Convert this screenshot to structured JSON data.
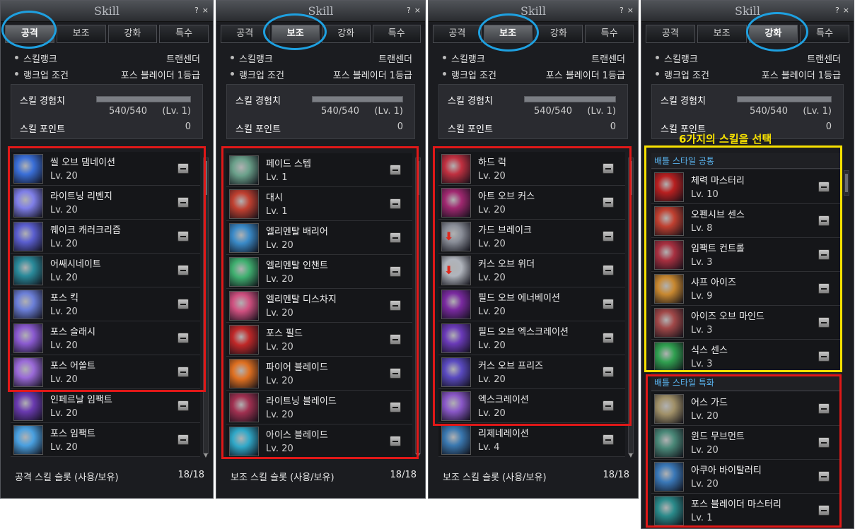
{
  "title": "Skill",
  "help": "?",
  "close": "×",
  "tabs": [
    "공격",
    "보조",
    "강화",
    "특수"
  ],
  "info": {
    "rank_label": "스킬랭크",
    "rank_value": "트랜센더",
    "cond_label": "랭크업 조건",
    "cond_value": "포스 블레이더 1등급"
  },
  "exp": {
    "label": "스킬 경험치",
    "value": "540/540",
    "level": "(Lv. 1)",
    "progress": 1.0
  },
  "points": {
    "label": "스킬 포인트",
    "value": "0"
  },
  "panels": [
    {
      "active_tab": 0,
      "footer_label": "공격 스킬 슬롯 (사용/보유)",
      "footer_value": "18/18",
      "skills": [
        {
          "name": "씰 오브 댐네이션",
          "lv": "Lv. 20",
          "color": "#3a6fd8",
          "icon": "sphere-icon"
        },
        {
          "name": "라이트닝 리벤지",
          "lv": "Lv. 20",
          "color": "#7f7fe8",
          "icon": "lightning-icon"
        },
        {
          "name": "퀘이크 캐러크리즘",
          "lv": "Lv. 20",
          "color": "#5b5fd0",
          "icon": "quake-icon"
        },
        {
          "name": "어쌔시네이트",
          "lv": "Lv. 20",
          "color": "#2a8a9a",
          "icon": "assassin-icon"
        },
        {
          "name": "포스 킥",
          "lv": "Lv. 20",
          "color": "#6b7fd8",
          "icon": "kick-icon"
        },
        {
          "name": "포스 슬래시",
          "lv": "Lv. 20",
          "color": "#8a5ad0",
          "icon": "slash-icon"
        },
        {
          "name": "포스 어쏠트",
          "lv": "Lv. 20",
          "color": "#9a6ad8",
          "icon": "assault-icon"
        },
        {
          "name": "인페르날 임팩트",
          "lv": "Lv. 20",
          "color": "#6a3ab0",
          "icon": "infernal-icon"
        },
        {
          "name": "포스 임팩트",
          "lv": "Lv. 20",
          "color": "#4aa0e0",
          "icon": "impact-icon"
        }
      ]
    },
    {
      "active_tab": 1,
      "footer_label": "보조 스킬 슬롯 (사용/보유)",
      "footer_value": "18/18",
      "skills": [
        {
          "name": "페이드 스텝",
          "lv": "Lv. 1",
          "color": "#6aa08a",
          "icon": "step-icon"
        },
        {
          "name": "대시",
          "lv": "Lv. 1",
          "color": "#c04030",
          "icon": "dash-icon"
        },
        {
          "name": "엘리멘탈 배리어",
          "lv": "Lv. 20",
          "color": "#3a8ac8",
          "icon": "barrier-icon"
        },
        {
          "name": "엘리멘탈 인챈트",
          "lv": "Lv. 20",
          "color": "#40b070",
          "icon": "enchant-icon"
        },
        {
          "name": "엘리멘탈 디스차지",
          "lv": "Lv. 20",
          "color": "#d05080",
          "icon": "discharge-icon"
        },
        {
          "name": "포스 필드",
          "lv": "Lv. 20",
          "color": "#c02828",
          "icon": "field-icon"
        },
        {
          "name": "파이어 블레이드",
          "lv": "Lv. 20",
          "color": "#e07020",
          "icon": "fire-blade-icon"
        },
        {
          "name": "라이트닝 블레이드",
          "lv": "Lv. 20",
          "color": "#a03050",
          "icon": "lightning-blade-icon"
        },
        {
          "name": "아이스 블레이드",
          "lv": "Lv. 20",
          "color": "#30a8c8",
          "icon": "ice-blade-icon"
        }
      ]
    },
    {
      "active_tab": 1,
      "footer_label": "보조 스킬 슬롯 (사용/보유)",
      "footer_value": "18/18",
      "skills": [
        {
          "name": "하드 럭",
          "lv": "Lv. 20",
          "color": "#c03040",
          "icon": "hard-luck-icon"
        },
        {
          "name": "아트 오브 커스",
          "lv": "Lv. 20",
          "color": "#a02870",
          "icon": "curse-icon"
        },
        {
          "name": "가드 브레이크",
          "lv": "Lv. 20",
          "color": "#8a8e98",
          "icon": "guard-break-icon",
          "debuff": true
        },
        {
          "name": "커스 오브 위더",
          "lv": "Lv. 20",
          "color": "#b0b4bc",
          "icon": "wither-icon",
          "debuff": true
        },
        {
          "name": "필드 오브 에너베이션",
          "lv": "Lv. 20",
          "color": "#7a2aa0",
          "icon": "enervation-icon"
        },
        {
          "name": "필드 오브 엑스크레이션",
          "lv": "Lv. 20",
          "color": "#6a3ab8",
          "icon": "execration-icon"
        },
        {
          "name": "커스 오브 프리즈",
          "lv": "Lv. 20",
          "color": "#5a4ac0",
          "icon": "freeze-icon"
        },
        {
          "name": "엑스크레이션",
          "lv": "Lv. 20",
          "color": "#8a58c8",
          "icon": "execration2-icon"
        },
        {
          "name": "리제네레이션",
          "lv": "Lv. 4",
          "color": "#3a78b0",
          "icon": "regeneration-icon"
        }
      ]
    },
    {
      "active_tab": 2,
      "caption": "6가지의 스킬을 선택",
      "section_common": "배틀 스타일 공통",
      "section_special": "배틀 스타일 특화",
      "skills_common": [
        {
          "name": "체력 마스터리",
          "lv": "Lv. 10",
          "color": "#b82020",
          "icon": "potion-icon"
        },
        {
          "name": "오펜시브 센스",
          "lv": "Lv. 8",
          "color": "#c04030",
          "icon": "offensive-icon"
        },
        {
          "name": "임팩트 컨트롤",
          "lv": "Lv. 3",
          "color": "#a83040",
          "icon": "control-icon"
        },
        {
          "name": "샤프 아이즈",
          "lv": "Lv. 9",
          "color": "#c88830",
          "icon": "eye-icon"
        },
        {
          "name": "아이즈 오브 마인드",
          "lv": "Lv. 3",
          "color": "#a04848",
          "icon": "mind-eye-icon"
        },
        {
          "name": "식스 센스",
          "lv": "Lv. 3",
          "color": "#30a050",
          "icon": "sixth-sense-icon"
        }
      ],
      "skills_special": [
        {
          "name": "어스 가드",
          "lv": "Lv. 20",
          "color": "#a09068",
          "icon": "earth-guard-icon"
        },
        {
          "name": "윈드 무브먼트",
          "lv": "Lv. 20",
          "color": "#4a8878",
          "icon": "wind-icon"
        },
        {
          "name": "아쿠아 바이탈러티",
          "lv": "Lv. 20",
          "color": "#3a78b8",
          "icon": "aqua-icon"
        },
        {
          "name": "포스 블레이더 마스터리",
          "lv": "Lv. 1",
          "color": "#2a8a8a",
          "icon": "mastery-icon"
        }
      ]
    }
  ]
}
